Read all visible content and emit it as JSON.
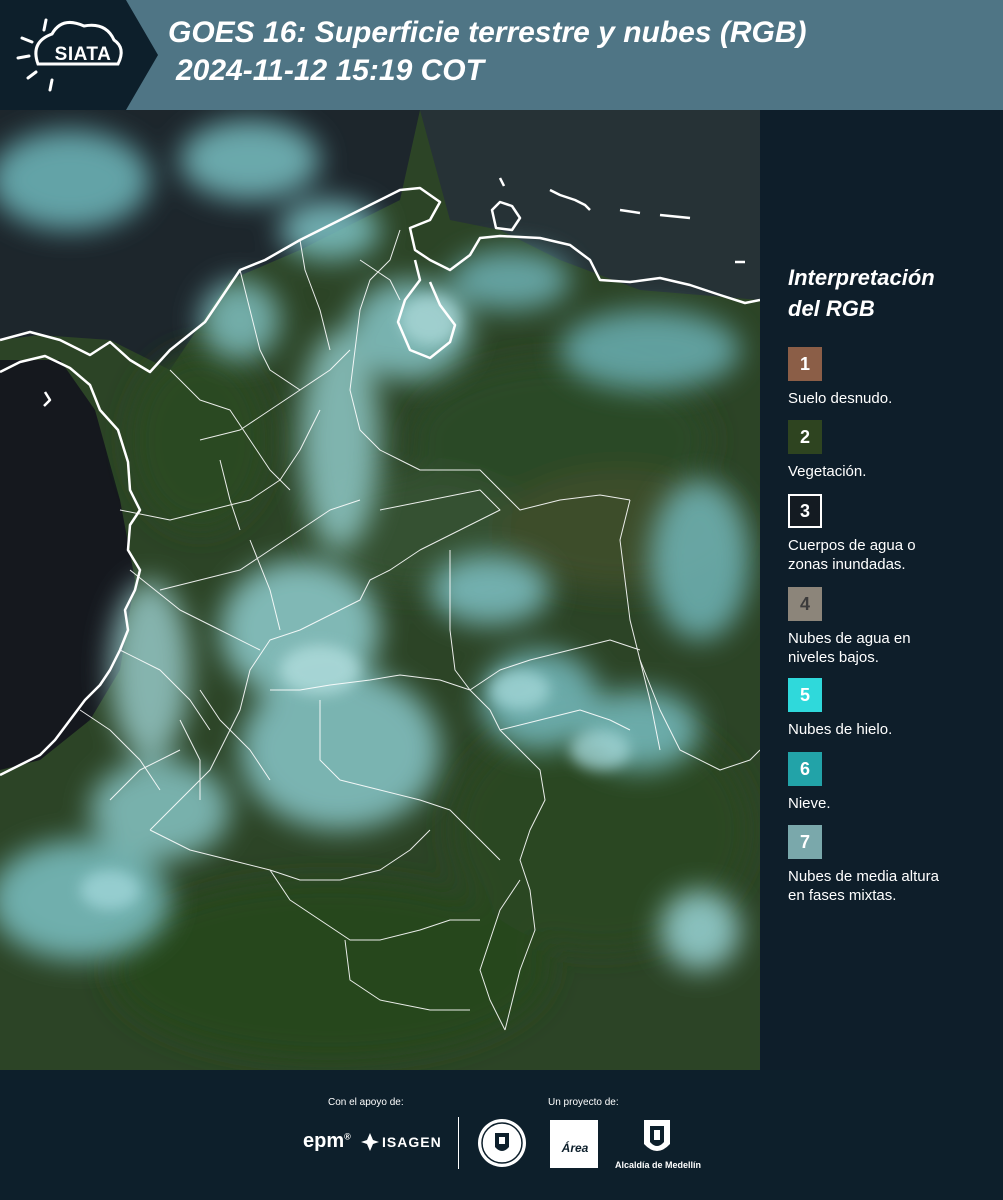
{
  "header": {
    "logo_text": "SIATA",
    "title_line1": "GOES 16: Superficie terrestre y nubes (RGB)",
    "title_line2": "2024-11-12 15:19 COT"
  },
  "legend": {
    "title_line1": "Interpretación",
    "title_line2": "del RGB",
    "items": [
      {
        "number": "1",
        "label_line1": "Suelo desnudo.",
        "label_line2": "",
        "color": "#8b5e47"
      },
      {
        "number": "2",
        "label_line1": "Vegetación.",
        "label_line2": "",
        "color": "#2e4420"
      },
      {
        "number": "3",
        "label_line1": "Cuerpos de agua o",
        "label_line2": "zonas inundadas.",
        "color": "#141b22"
      },
      {
        "number": "4",
        "label_line1": "Nubes de agua en",
        "label_line2": "niveles bajos.",
        "color": "#8c857a"
      },
      {
        "number": "5",
        "label_line1": "Nubes de hielo.",
        "label_line2": "",
        "color": "#2fd9db"
      },
      {
        "number": "6",
        "label_line1": "Nieve.",
        "label_line2": "",
        "color": "#22a3a8"
      },
      {
        "number": "7",
        "label_line1": "Nubes de media altura",
        "label_line2": "en fases mixtas.",
        "color": "#7aa8ab"
      }
    ]
  },
  "footer": {
    "support_label": "Con el apoyo de:",
    "project_label": "Un proyecto de:",
    "epm": "epm",
    "isagen": "ISAGEN",
    "area_text": "Área",
    "alcaldia": "Alcaldía de Medellín"
  },
  "colors": {
    "header_bg": "#4f7585",
    "logo_bg": "#0d1f2b",
    "legend_bg": "#0e1e2a",
    "vegetation": "#2e4420",
    "clouds": "#7fc9cc",
    "ocean": "#14161c",
    "borders": "#ffffff"
  }
}
